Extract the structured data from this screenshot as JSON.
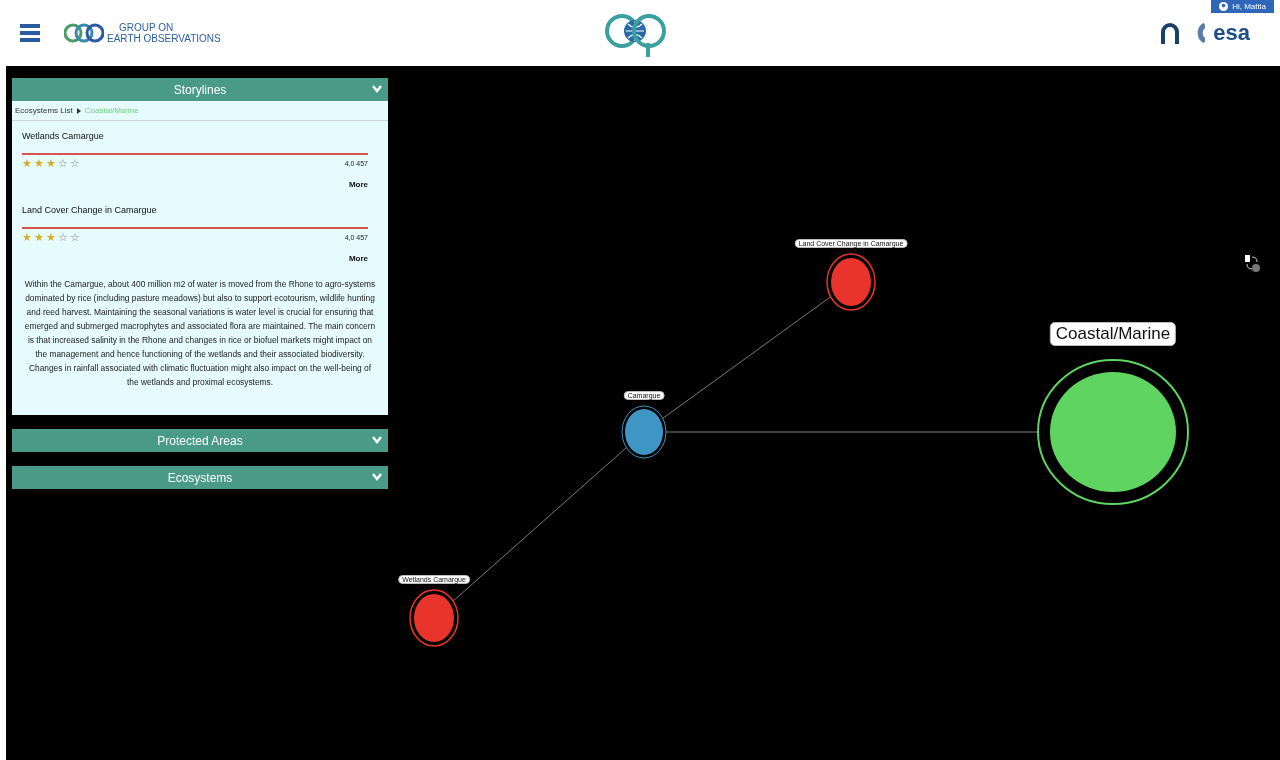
{
  "header": {
    "org_name_line1": "GROUP ON",
    "org_name_line2": "EARTH OBSERVATIONS",
    "user": "Hi, Mattia",
    "partner_logo_text": "esa"
  },
  "panels": [
    {
      "title": "Storylines",
      "expanded": true
    },
    {
      "title": "Protected Areas",
      "expanded": false
    },
    {
      "title": "Ecosystems",
      "expanded": false
    }
  ],
  "breadcrumb": [
    "Ecosystems List",
    "Coastal/Marine"
  ],
  "storylines": [
    {
      "title": "Wetlands Camargue",
      "stars": 3,
      "rating": "4,0 457",
      "more": "More"
    },
    {
      "title": "Land Cover Change in Camargue",
      "stars": 3,
      "rating": "4,0 457",
      "more": "More"
    }
  ],
  "description": "Within the Camargue, about 400 million m2 of water is moved from the Rhone to agro-systems dominated by rice (including pasture meadows) but also to support ecotourism, wildlife hunting and reed harvest. Maintaining the seasonal variations is water level is crucial for ensuring that emerged and submerged macrophytes and associated flora are maintained. The main concern is that increased salinity in the Rhone and changes in rice or biofuel markets might impact on the management and hence functioning of the wetlands and their associated biodiversity. Changes in rainfall associated with climatic fluctuation might also impact on the well-being of the wetlands and proximal ecosystems.",
  "graph": {
    "nodes": [
      {
        "label": "Land Cover Change in Camargue",
        "kind": "storyline",
        "color": "#e8342a"
      },
      {
        "label": "Coastal/Marine",
        "kind": "ecosystem",
        "color": "#5fd460"
      },
      {
        "label": "Camargue",
        "kind": "site",
        "color": "#3f95c4"
      },
      {
        "label": "Wetlands Camargue",
        "kind": "storyline",
        "color": "#e8342a"
      }
    ]
  }
}
